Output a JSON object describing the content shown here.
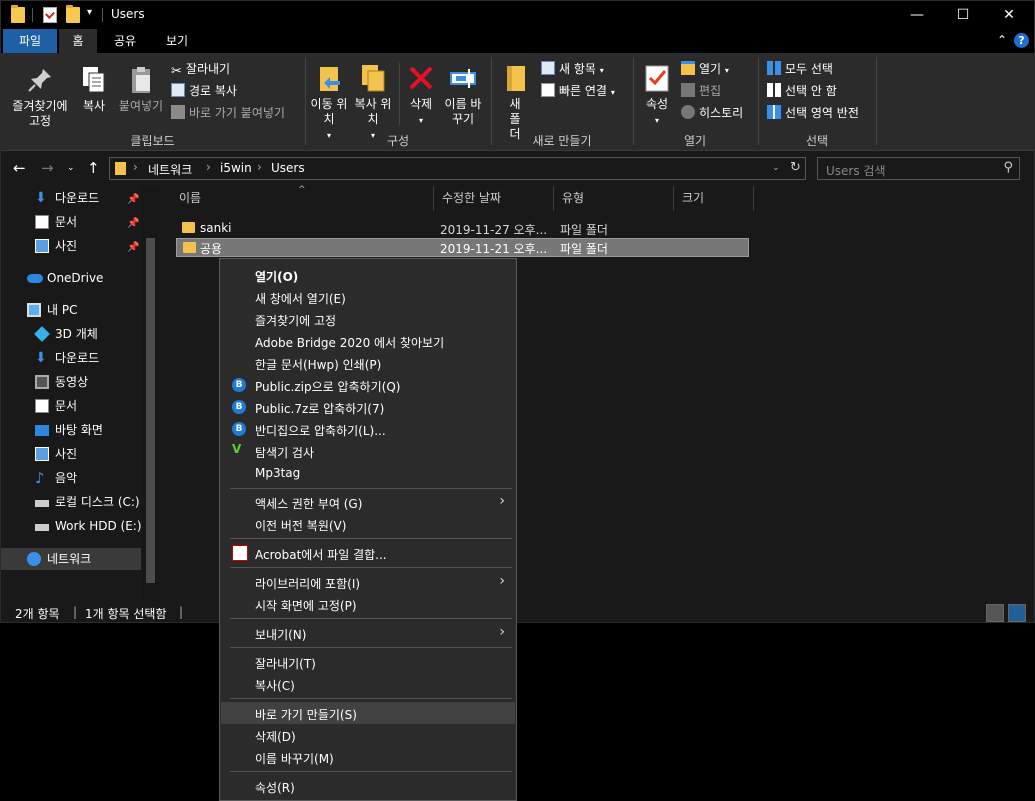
{
  "window": {
    "title": "Users",
    "buttons": {
      "minimize": "—",
      "maximize": "☐",
      "close": "✕"
    }
  },
  "ribbon_tabs": [
    "파일",
    "홈",
    "공유",
    "보기"
  ],
  "ribbon": {
    "clipboard": {
      "pin": "즐겨찾기에 고정",
      "copy": "복사",
      "paste": "붙여넣기",
      "cut": "잘라내기",
      "copy_path": "경로 복사",
      "paste_shortcut": "바로 가기 붙여넣기",
      "group_label": "클립보드"
    },
    "organize": {
      "move_to": "이동 위치",
      "copy_to": "복사 위치",
      "delete": "삭제",
      "rename": "이름 바꾸기",
      "group_label": "구성"
    },
    "new": {
      "new_folder": "새 폴더",
      "new_item": "새 항목",
      "easy_access": "빠른 연결",
      "group_label": "새로 만들기"
    },
    "open": {
      "properties": "속성",
      "open": "열기",
      "edit": "편집",
      "history": "히스토리",
      "group_label": "열기"
    },
    "select": {
      "select_all": "모두 선택",
      "select_none": "선택 안 함",
      "invert": "선택 영역 반전",
      "group_label": "선택"
    }
  },
  "address": {
    "crumbs": [
      "네트워크",
      "i5win",
      "Users"
    ],
    "search_placeholder": "Users 검색"
  },
  "nav": {
    "items": [
      {
        "label": "다운로드",
        "icon": "download-arrow-icon",
        "pinned": true
      },
      {
        "label": "문서",
        "icon": "document-icon",
        "pinned": true
      },
      {
        "label": "사진",
        "icon": "pictures-icon",
        "pinned": true
      },
      {
        "label": "OneDrive",
        "icon": "cloud-icon"
      },
      {
        "label": "내 PC",
        "icon": "computer-icon"
      },
      {
        "label": "3D 개체",
        "icon": "cube-icon"
      },
      {
        "label": "다운로드",
        "icon": "download-arrow-icon"
      },
      {
        "label": "동영상",
        "icon": "video-icon"
      },
      {
        "label": "문서",
        "icon": "document-icon"
      },
      {
        "label": "바탕 화면",
        "icon": "desktop-icon"
      },
      {
        "label": "사진",
        "icon": "pictures-icon"
      },
      {
        "label": "음악",
        "icon": "music-icon"
      },
      {
        "label": "로컬 디스크 (C:)",
        "icon": "drive-icon"
      },
      {
        "label": "Work HDD (E:)",
        "icon": "drive-icon"
      },
      {
        "label": "네트워크",
        "icon": "network-icon",
        "selected": true
      }
    ]
  },
  "filelist": {
    "columns": [
      "이름",
      "수정한 날짜",
      "유형",
      "크기"
    ],
    "rows": [
      {
        "name": "sanki",
        "date": "2019-11-27 오후...",
        "type": "파일 폴더",
        "size": ""
      },
      {
        "name": "공용",
        "date": "2019-11-21 오후...",
        "type": "파일 폴더",
        "size": "",
        "selected": true
      }
    ]
  },
  "status": {
    "count": "2개 항목",
    "selected": "1개 항목 선택함"
  },
  "context_menu": {
    "items": [
      "열기(O)",
      "새 창에서 열기(E)",
      "즐겨찾기에 고정",
      "Adobe Bridge 2020 에서 찾아보기",
      "한글 문서(Hwp) 인쇄(P)",
      "Public.zip으로 압축하기(Q)",
      "Public.7z로 압축하기(7)",
      "반디집으로 압축하기(L)...",
      "탐색기 검사",
      "Mp3tag",
      "액세스 권한 부여 (G)",
      "이전 버전 복원(V)",
      "Acrobat에서 파일 결합...",
      "라이브러리에 포함(I)",
      "시작 화면에 고정(P)",
      "보내기(N)",
      "잘라내기(T)",
      "복사(C)",
      "바로 가기 만들기(S)",
      "삭제(D)",
      "이름 바꾸기(M)",
      "속성(R)"
    ],
    "submenu_arrow": "›",
    "highlight_color": "#414141"
  },
  "colors": {
    "accent": "#1e5fa6",
    "folder": "#f3c24d",
    "delete_red": "#e81123"
  }
}
